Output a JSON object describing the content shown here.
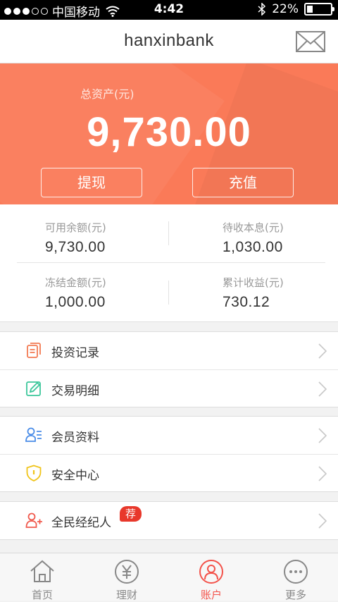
{
  "status_bar": {
    "carrier": "中国移动",
    "time": "4:42",
    "battery": "22%",
    "battery_level": 0.22
  },
  "header": {
    "title": "hanxinbank",
    "mail_icon": "mail-icon"
  },
  "assets": {
    "label": "总资产(元)",
    "amount": "9,730.00",
    "withdraw_label": "提现",
    "recharge_label": "充值"
  },
  "stats": [
    {
      "label": "可用余额(元)",
      "value": "9,730.00"
    },
    {
      "label": "待收本息(元)",
      "value": "1,030.00"
    },
    {
      "label": "冻结金额(元)",
      "value": "1,000.00"
    },
    {
      "label": "累计收益(元)",
      "value": "730.12"
    }
  ],
  "menu_groups": [
    [
      {
        "label": "投资记录",
        "icon": "document-icon"
      },
      {
        "label": "交易明细",
        "icon": "edit-icon"
      }
    ],
    [
      {
        "label": "会员资料",
        "icon": "user-card-icon"
      },
      {
        "label": "安全中心",
        "icon": "shield-icon"
      }
    ],
    [
      {
        "label": "全民经纪人",
        "icon": "add-user-icon",
        "badge": "荐"
      }
    ]
  ],
  "tabs": [
    {
      "label": "首页",
      "icon": "home-icon",
      "active": false
    },
    {
      "label": "理财",
      "icon": "yuan-icon",
      "active": false
    },
    {
      "label": "账户",
      "icon": "account-icon",
      "active": true
    },
    {
      "label": "更多",
      "icon": "more-icon",
      "active": false
    }
  ],
  "colors": {
    "accent": "#fa7a58",
    "active_tab": "#f3524a",
    "badge": "#e8382b"
  }
}
